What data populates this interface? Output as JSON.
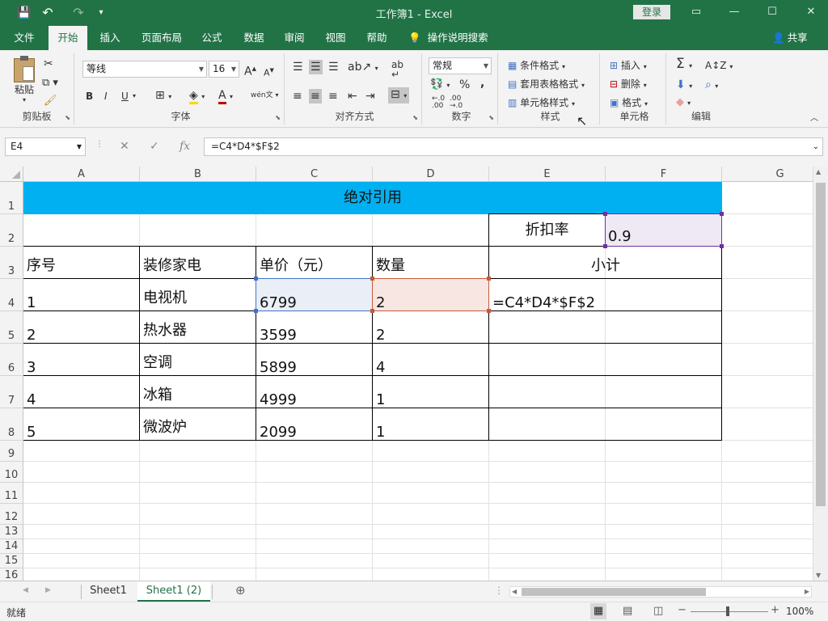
{
  "titlebar": {
    "title": "工作簿1  -  Excel",
    "login": "登录",
    "qa_save": "💾",
    "qa_undo": "↶",
    "qa_redo": "↷",
    "qa_more": "▾"
  },
  "tabs": [
    "文件",
    "开始",
    "插入",
    "页面布局",
    "公式",
    "数据",
    "审阅",
    "视图",
    "帮助"
  ],
  "tellme": "操作说明搜索",
  "share": "共享",
  "ribbon": {
    "clipboard": {
      "paste": "粘贴",
      "label": "剪贴板"
    },
    "font": {
      "name": "等线",
      "size": "16",
      "label": "字体",
      "bold": "B",
      "italic": "I",
      "underline": "U",
      "grow": "A",
      "shrink": "A",
      "wen": "wén"
    },
    "align": {
      "label": "对齐方式"
    },
    "number": {
      "format": "常规",
      "label": "数字",
      "percent": "%",
      "comma": ","
    },
    "styles": {
      "cond": "条件格式",
      "table": "套用表格格式",
      "cell": "单元格样式",
      "label": "样式"
    },
    "cells": {
      "insert": "插入",
      "delete": "删除",
      "format": "格式",
      "label": "单元格"
    },
    "editing": {
      "label": "编辑",
      "sum": "Σ"
    }
  },
  "formulabar": {
    "namebox": "E4",
    "fx": "fx",
    "formula": "=C4*D4*$F$2"
  },
  "columns": [
    "A",
    "B",
    "C",
    "D",
    "E",
    "F",
    "G"
  ],
  "rows": [
    "1",
    "2",
    "3",
    "4",
    "5",
    "6",
    "7",
    "8",
    "9",
    "10",
    "11",
    "12",
    "13",
    "14",
    "15",
    "16"
  ],
  "cells": {
    "title": "绝对引用",
    "discount_label": "折扣率",
    "discount_value": "0.9",
    "h_no": "序号",
    "h_item": "装修家电",
    "h_price": "单价（元）",
    "h_qty": "数量",
    "h_subtotal": "小计",
    "data": [
      {
        "no": "1",
        "item": "电视机",
        "price": "6799",
        "qty": "2",
        "sub": "=C4*D4*$F$2"
      },
      {
        "no": "2",
        "item": "热水器",
        "price": "3599",
        "qty": "2",
        "sub": ""
      },
      {
        "no": "3",
        "item": "空调",
        "price": "5899",
        "qty": "4",
        "sub": ""
      },
      {
        "no": "4",
        "item": "冰箱",
        "price": "4999",
        "qty": "1",
        "sub": ""
      },
      {
        "no": "5",
        "item": "微波炉",
        "price": "2099",
        "qty": "1",
        "sub": ""
      }
    ]
  },
  "sheets": [
    "Sheet1",
    "Sheet1 (2)"
  ],
  "status": {
    "ready": "就绪",
    "zoom": "100%"
  },
  "colors": {
    "accent": "#217346",
    "title_fill": "#00b0f0",
    "c4_fill": "#e9eef7",
    "d4_fill": "#f8e6e3",
    "f2_fill": "#eee9f5"
  }
}
